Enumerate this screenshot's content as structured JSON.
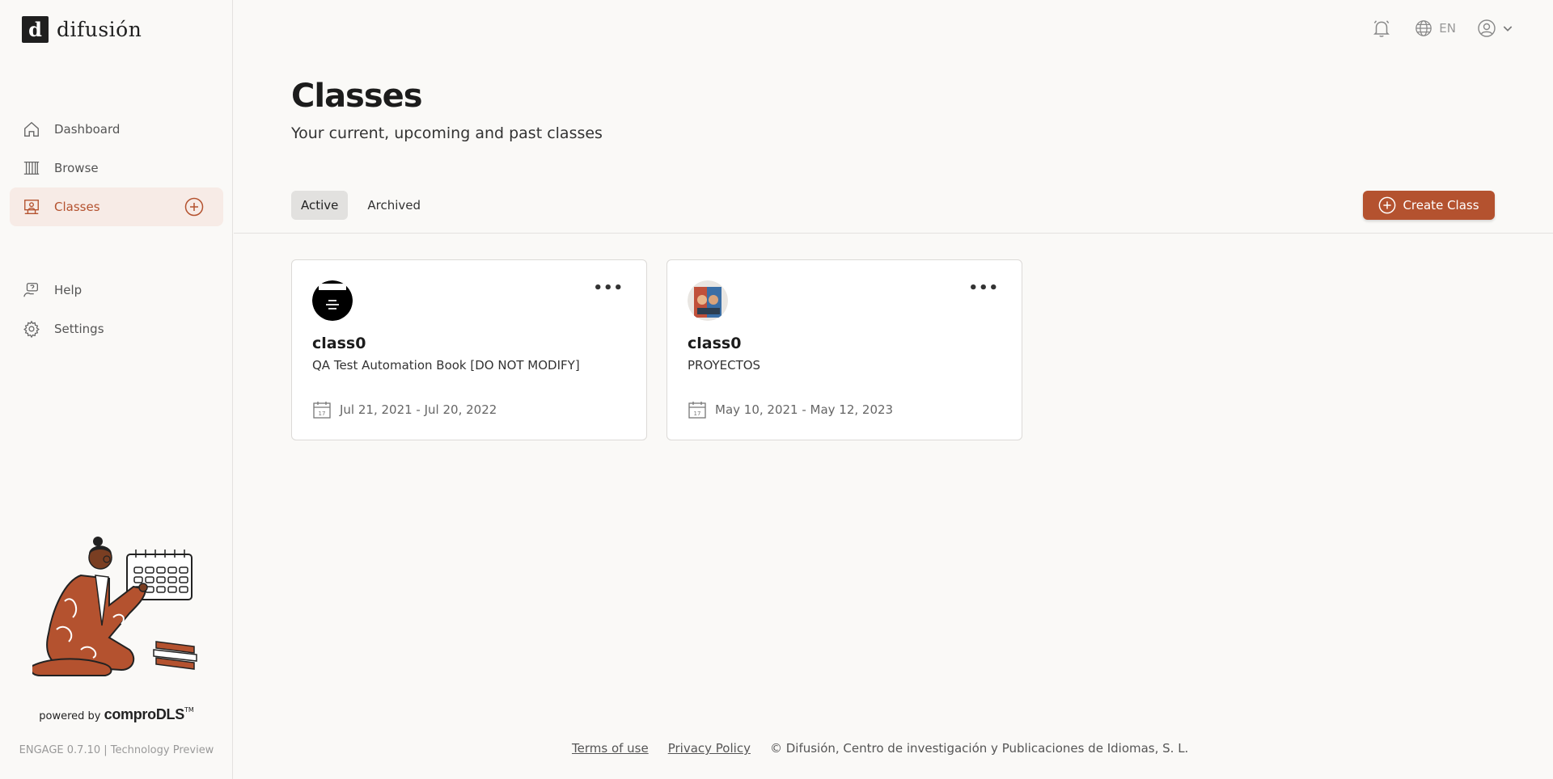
{
  "brand": {
    "logo_mark": "d",
    "logo_text": "difusión"
  },
  "sidebar": {
    "main_items": [
      {
        "label": "Dashboard",
        "icon": "home-icon"
      },
      {
        "label": "Browse",
        "icon": "books-icon"
      },
      {
        "label": "Classes",
        "icon": "classroom-icon",
        "active": true
      }
    ],
    "secondary_items": [
      {
        "label": "Help",
        "icon": "help-icon"
      },
      {
        "label": "Settings",
        "icon": "gear-icon"
      }
    ],
    "powered_prefix": "powered by",
    "powered_brand": "comproDLS",
    "powered_tm": "TM",
    "version": "ENGAGE 0.7.10 | Technology Preview"
  },
  "topbar": {
    "language": "EN"
  },
  "main": {
    "title": "Classes",
    "subtitle": "Your current, upcoming and past classes",
    "tabs": [
      {
        "label": "Active",
        "active": true
      },
      {
        "label": "Archived",
        "active": false
      }
    ],
    "create_button": "Create Class",
    "cards": [
      {
        "name": "class0",
        "book": "QA Test Automation Book [DO NOT MODIFY]",
        "dates": "Jul 21, 2021 - Jul 20, 2022",
        "calendar_day": "17",
        "more": "•••"
      },
      {
        "name": "class0",
        "book": "PROYECTOS",
        "dates": "May 10, 2021 - May 12, 2023",
        "calendar_day": "17",
        "more": "•••"
      }
    ]
  },
  "footer": {
    "terms": "Terms of use",
    "privacy": "Privacy Policy",
    "copyright": "© Difusión, Centro de investigación y Publicaciones de Idiomas, S. L."
  },
  "colors": {
    "accent": "#b4522f",
    "active_bg": "#f7ebe6",
    "page_bg": "#faf9f7"
  }
}
